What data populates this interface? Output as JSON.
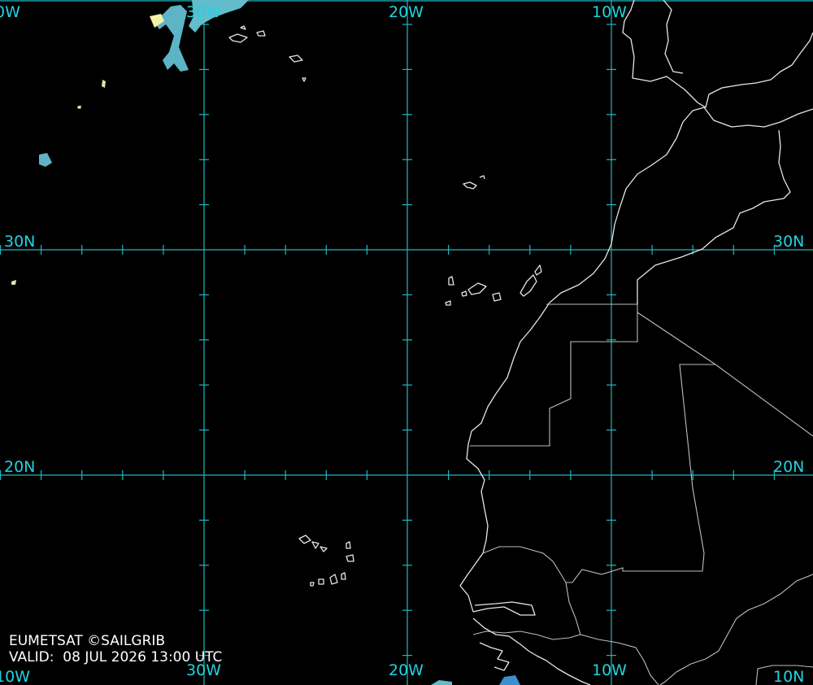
{
  "map": {
    "region": "Eastern North Atlantic / North-West Africa",
    "background_color": "#000000",
    "grid_color": "#1fb8c2",
    "coast_color": "#e6e6e6",
    "cloud_color": "#5fb8c8",
    "longitude_labels": {
      "top": [
        "0W",
        "30W",
        "20W",
        "10W"
      ],
      "bottom": [
        "10W",
        "30W",
        "20W",
        "10W",
        "10N"
      ]
    },
    "latitude_labels": {
      "left": [
        "30N",
        "20N"
      ],
      "right": [
        "30N",
        "20N"
      ]
    },
    "credit": "EUMETSAT ©SAILGRIB",
    "valid": "VALID:  08 JUL 2026 13:00 UTC"
  }
}
